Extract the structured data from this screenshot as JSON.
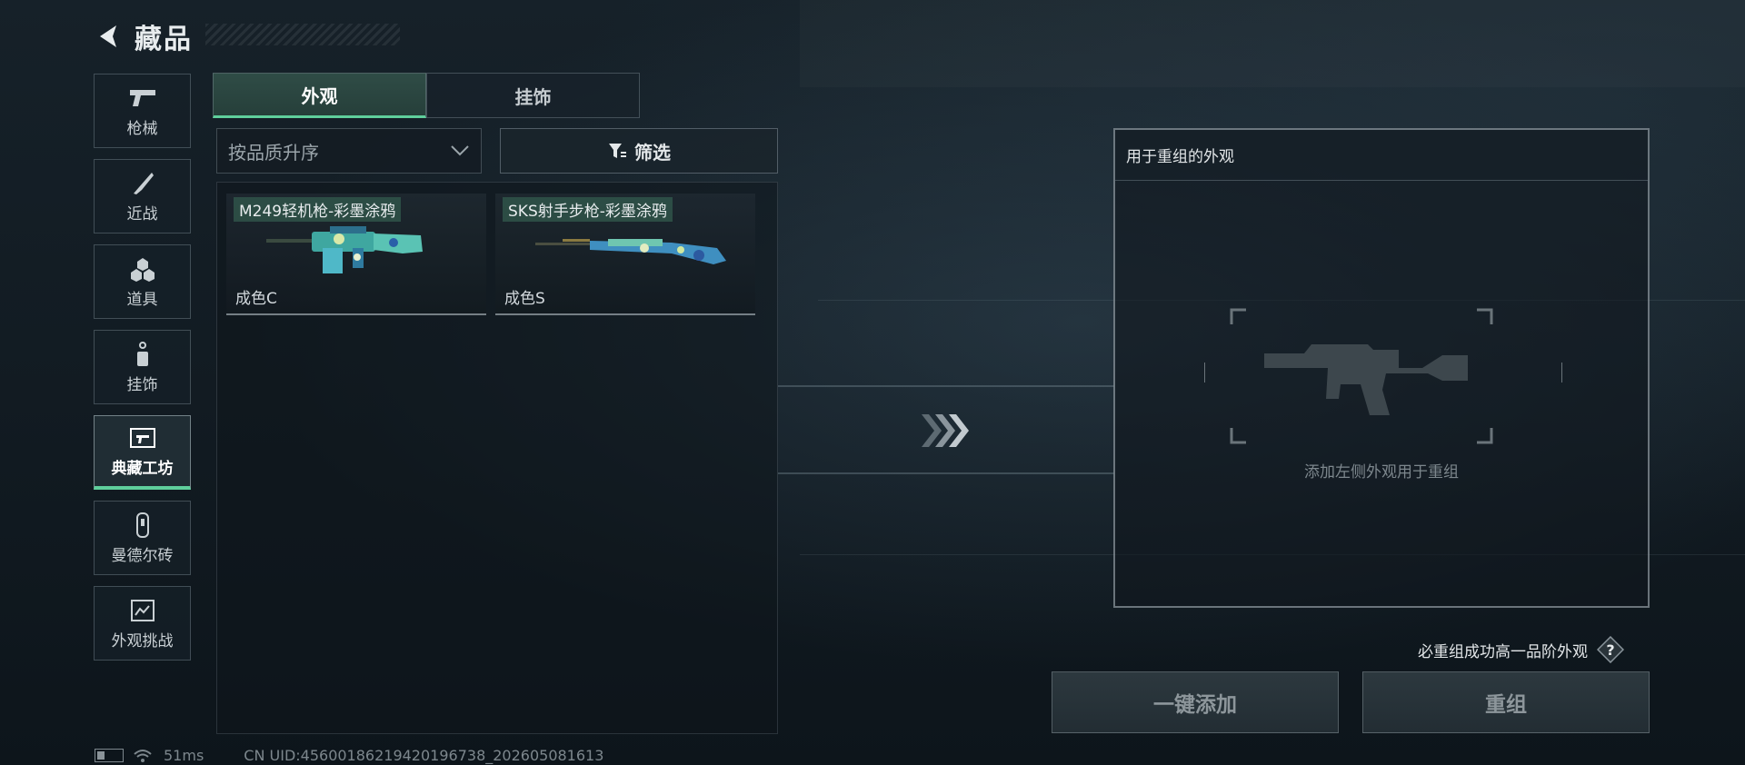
{
  "header": {
    "title": "藏品"
  },
  "sidebar": {
    "items": [
      {
        "label": "枪械",
        "icon": "pistol-icon",
        "active": false
      },
      {
        "label": "近战",
        "icon": "knife-icon",
        "active": false
      },
      {
        "label": "道具",
        "icon": "grenade-icon",
        "active": false
      },
      {
        "label": "挂饰",
        "icon": "charm-icon",
        "active": false
      },
      {
        "label": "典藏工坊",
        "icon": "workshop-icon",
        "active": true
      },
      {
        "label": "曼德尔砖",
        "icon": "brick-icon",
        "active": false
      },
      {
        "label": "外观挑战",
        "icon": "challenge-icon",
        "active": false
      }
    ]
  },
  "tabs": [
    {
      "label": "外观",
      "active": true
    },
    {
      "label": "挂饰",
      "active": false
    }
  ],
  "sort": {
    "value": "按品质升序"
  },
  "filter": {
    "label": "筛选"
  },
  "inventory": {
    "items": [
      {
        "name": "M249轻机枪-彩墨涂鸦",
        "quality": "成色C"
      },
      {
        "name": "SKS射手步枪-彩墨涂鸦",
        "quality": "成色S"
      }
    ]
  },
  "recombine": {
    "header": "用于重组的外观",
    "hint": "添加左侧外观用于重组",
    "guarantee_text": "必重组成功高一品阶外观",
    "add_button": "一键添加",
    "recombine_button": "重组"
  },
  "status": {
    "ping": "51ms",
    "uid": "CN UID:456001862194201967​38_202605081613"
  },
  "colors": {
    "accent": "#5fcf9c",
    "tab_active_bg": "#2f4c46"
  }
}
